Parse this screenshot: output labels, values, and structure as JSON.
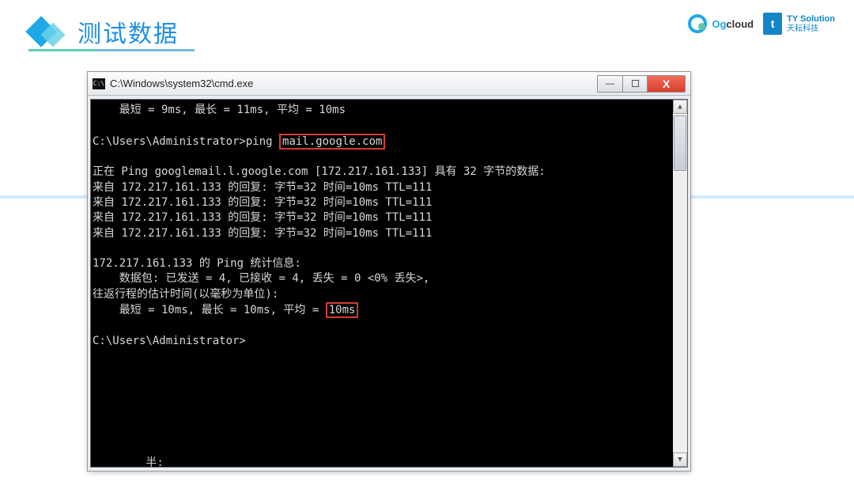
{
  "header": {
    "title": "测试数据",
    "logo1_prefix": "Og",
    "logo1_suffix": "cloud",
    "logo2_badge": "t",
    "logo2_en": "TY Solution",
    "logo2_cn": "天耘科技"
  },
  "window": {
    "title": "C:\\Windows\\system32\\cmd.exe"
  },
  "highlight": {
    "host": "mail.google.com",
    "avg": "10ms"
  },
  "term_before_host": "    最短 = 9ms, 最长 = 11ms, 平均 = 10ms\n\nC:\\Users\\Administrator>ping ",
  "term_after_host": "\n\n正在 Ping googlemail.l.google.com [172.217.161.133] 具有 32 字节的数据:\n来自 172.217.161.133 的回复: 字节=32 时间=10ms TTL=111\n来自 172.217.161.133 的回复: 字节=32 时间=10ms TTL=111\n来自 172.217.161.133 的回复: 字节=32 时间=10ms TTL=111\n来自 172.217.161.133 的回复: 字节=32 时间=10ms TTL=111\n\n172.217.161.133 的 Ping 统计信息:\n    数据包: 已发送 = 4, 已接收 = 4, 丢失 = 0 <0% 丢失>,\n往返行程的估计时间(以毫秒为单位):\n    最短 = 10ms, 最长 = 10ms, 平均 = ",
  "term_after_avg": "\n\nC:\\Users\\Administrator>\n\n\n\n\n\n\n\n        半:"
}
